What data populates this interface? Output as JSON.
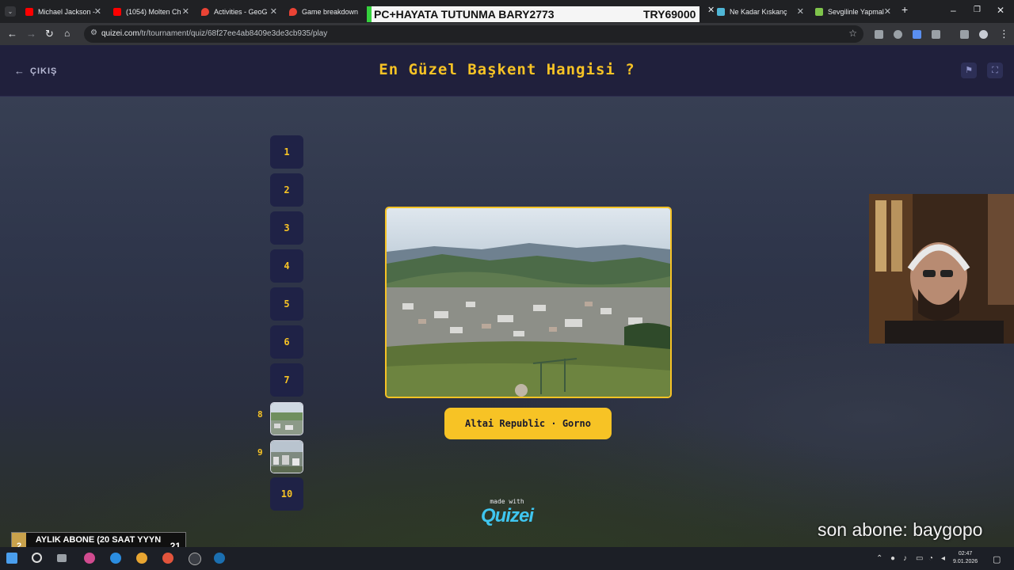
{
  "browser": {
    "tabs": [
      {
        "title": "Michael Jackson -",
        "icon": "youtube-icon",
        "color": "#ff0000"
      },
      {
        "title": "(1054) Molten Ch",
        "icon": "youtube-icon",
        "color": "#ff0000"
      },
      {
        "title": "Activities - GeoG",
        "icon": "location-pin-icon",
        "color": "#ea4335"
      },
      {
        "title": "Game breakdown",
        "icon": "location-pin-icon",
        "color": "#ea4335"
      },
      {
        "title": "Ne Kadar Kıskanç",
        "icon": "site-icon",
        "color": "#4fb6d6"
      },
      {
        "title": "Sevgilinle Yapmal",
        "icon": "site-icon",
        "color": "#7fc44b"
      }
    ],
    "overlay_banner": {
      "left": "PC+HAYATA TUTUNMA BARY2773",
      "right": "TRY69000"
    },
    "url_domain": "quizei.com",
    "url_path": "/tr/tournament/quiz/68f27ee4ab8409e3de3cb935/play"
  },
  "quiz": {
    "back_label": "ÇIKIŞ",
    "title": "En Güzel Başkent Hangisi ?",
    "rounds": [
      "1",
      "2",
      "3",
      "4",
      "5",
      "6",
      "7",
      "8",
      "9",
      "10"
    ],
    "answer_label": "Altai Republic · Gorno",
    "made_with": "made with",
    "brand": "Quizei"
  },
  "stream": {
    "last_sub": "son abone: baygopo",
    "sub_goal": {
      "left": "2",
      "text": "AYLIK ABONE (20 SAAT YYYN",
      "right": "21"
    }
  },
  "taskbar": {
    "time": "02:47",
    "date": "9.01.2026"
  },
  "colors": {
    "accent": "#f7c325",
    "header_bg": "#20203c",
    "round_bg": "#1f2246"
  }
}
